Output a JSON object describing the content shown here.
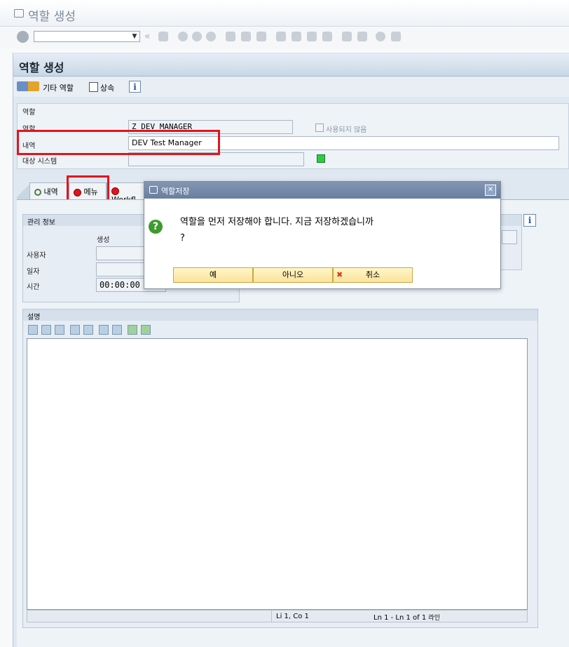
{
  "window": {
    "title": "역할 생성"
  },
  "app": {
    "title": "역할 생성"
  },
  "toolbar": {
    "other_role": "기타 역할",
    "inherit": "상속"
  },
  "header": {
    "section_label": "역할",
    "role_label": "역할",
    "role_value": "Z_DEV_MANAGER",
    "unused_label": "사용되지 않음",
    "desc_label": "내역",
    "desc_value": "DEV Test Manager",
    "target_label": "대상 시스템"
  },
  "tabs": [
    {
      "label": "내역"
    },
    {
      "label": "메뉴"
    },
    {
      "label": "Workfl"
    }
  ],
  "admin": {
    "title": "관리 정보",
    "created_label": "생성",
    "user_label": "사용자",
    "date_label": "일자",
    "time_label": "시간",
    "time_value": "00:00:00"
  },
  "desc_section": {
    "title": "설명"
  },
  "statusbar": {
    "cursor": "Li 1, Co 1",
    "lines": "Ln 1 - Ln 1 of 1",
    "line_unit": "라인"
  },
  "dialog": {
    "title": "역할저장",
    "message_line1": "역할을 먼저 저장해야 합니다. 지금 저장하겠습니까",
    "message_line2": "?",
    "yes": "예",
    "no": "아니오",
    "cancel": "취소"
  },
  "icons": {
    "info": "i",
    "close": "✕",
    "cancel": "✖",
    "help": "?"
  },
  "colors": {
    "highlight": "#e3131c",
    "status_green": "#2ecc40"
  }
}
